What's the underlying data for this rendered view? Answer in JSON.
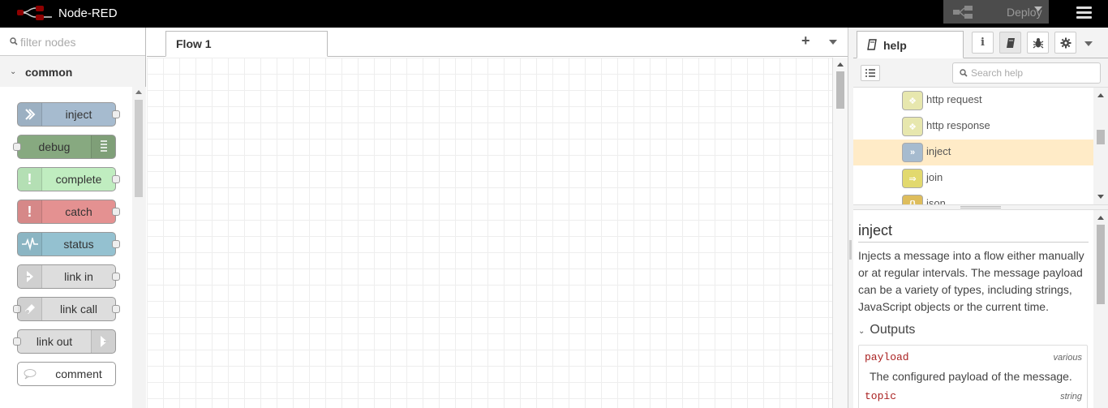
{
  "header": {
    "app_title": "Node-RED",
    "deploy_label": "Deploy",
    "icons": {
      "logo": "node-red-logo",
      "deploy": "deploy-icon",
      "menu": "hamburger-menu-icon"
    }
  },
  "palette": {
    "search_placeholder": "filter nodes",
    "category": "common",
    "nodes": [
      {
        "label": "inject",
        "color": "#a6bbcf",
        "icon": "arrow-in-icon"
      },
      {
        "label": "debug",
        "color": "#87a980",
        "icon": "debug-list-icon"
      },
      {
        "label": "complete",
        "color": "#c0edc0",
        "icon": "exclamation-icon"
      },
      {
        "label": "catch",
        "color": "#e49191",
        "icon": "exclamation-icon"
      },
      {
        "label": "status",
        "color": "#94c1d0",
        "icon": "pulse-icon"
      },
      {
        "label": "link in",
        "color": "#dddddd",
        "icon": "link-in-icon"
      },
      {
        "label": "link call",
        "color": "#dddddd",
        "icon": "link-call-icon"
      },
      {
        "label": "link out",
        "color": "#dddddd",
        "icon": "link-out-icon"
      },
      {
        "label": "comment",
        "color": "#ffffff",
        "icon": "comment-icon"
      }
    ]
  },
  "workspace": {
    "tabs": [
      {
        "label": "Flow 1"
      }
    ],
    "add_tab": "+"
  },
  "sidebar": {
    "active_tab": "help",
    "tab_buttons": [
      "info-icon",
      "book-icon",
      "bug-icon",
      "gear-icon"
    ],
    "search_placeholder": "Search help",
    "tree": [
      {
        "label": "http request",
        "color": "#e7e7ae"
      },
      {
        "label": "http response",
        "color": "#e7e7ae"
      },
      {
        "label": "inject",
        "color": "#a6bbcf",
        "selected": true
      },
      {
        "label": "join",
        "color": "#e2d96e"
      },
      {
        "label": "json",
        "color": "#debd5c"
      }
    ],
    "help": {
      "title": "inject",
      "description": "Injects a message into a flow either manually or at regular intervals. The message payload can be a variety of types, including strings, JavaScript objects or the current time.",
      "outputs_heading": "Outputs",
      "properties": [
        {
          "name": "payload",
          "type": "various",
          "description": "The configured payload of the message."
        },
        {
          "name": "topic",
          "type": "string"
        }
      ]
    }
  },
  "colors": {
    "header_bg": "#000000",
    "selected_row": "#ffebc7",
    "prop_name": "#aa2222"
  }
}
